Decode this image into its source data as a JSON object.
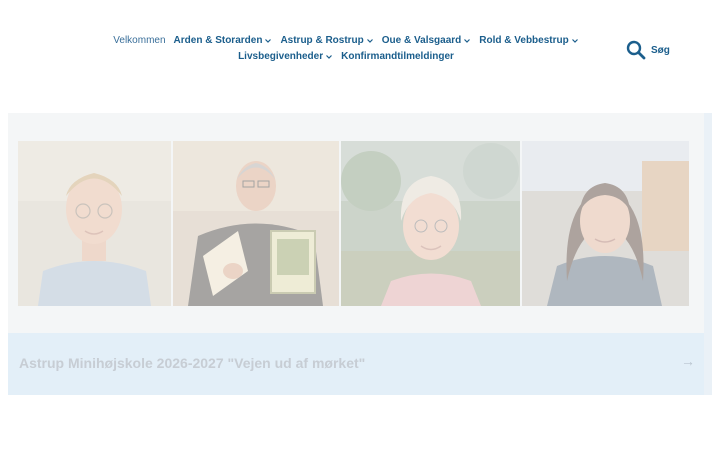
{
  "nav": {
    "items": [
      {
        "label": "Velkommen",
        "has_dropdown": false
      },
      {
        "label": "Arden & Storarden",
        "has_dropdown": true
      },
      {
        "label": "Astrup & Rostrup",
        "has_dropdown": true
      },
      {
        "label": "Oue & Valsgaard",
        "has_dropdown": true
      },
      {
        "label": "Rold & Vebbestrup",
        "has_dropdown": true
      },
      {
        "label": "Livsbegivenheder",
        "has_dropdown": true
      },
      {
        "label": "Konfirmandtilmeldinger",
        "has_dropdown": false
      }
    ],
    "active_index": 0
  },
  "search": {
    "label": "Søg",
    "icon": "search-icon"
  },
  "hero": {
    "title": "Astrup Minihøjskole 2026-2027 \"Vejen ud af mørket\"",
    "arrow": "→"
  },
  "colors": {
    "nav_text": "#1b5e8c",
    "footer_bg": "#e3eff8",
    "title_text": "#c7cdd4"
  }
}
